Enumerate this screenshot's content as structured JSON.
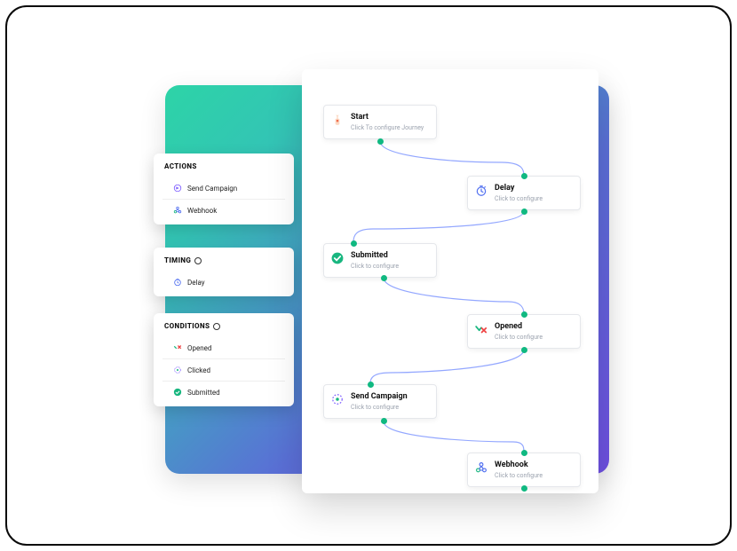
{
  "sidebar": {
    "actions": {
      "title": "ACTIONS",
      "items": [
        {
          "label": "Send Campaign",
          "icon": "send-campaign-icon"
        },
        {
          "label": "Webhook",
          "icon": "webhook-icon"
        }
      ]
    },
    "timing": {
      "title": "TIMING",
      "items": [
        {
          "label": "Delay",
          "icon": "delay-icon"
        }
      ]
    },
    "conditions": {
      "title": "CONDITIONS",
      "items": [
        {
          "label": "Opened",
          "icon": "opened-icon"
        },
        {
          "label": "Clicked",
          "icon": "clicked-icon"
        },
        {
          "label": "Submitted",
          "icon": "submitted-icon"
        }
      ]
    }
  },
  "flow": {
    "start": {
      "title": "Start",
      "sub": "Click To configure Journey"
    },
    "delay": {
      "title": "Delay",
      "sub": "Click to configure"
    },
    "submitted": {
      "title": "Submitted",
      "sub": "Click to configure"
    },
    "opened": {
      "title": "Opened",
      "sub": "Click to configure"
    },
    "sendCampaign": {
      "title": "Send Campaign",
      "sub": "Click to configure"
    },
    "webhook": {
      "title": "Webhook",
      "sub": "Click to configure"
    }
  }
}
